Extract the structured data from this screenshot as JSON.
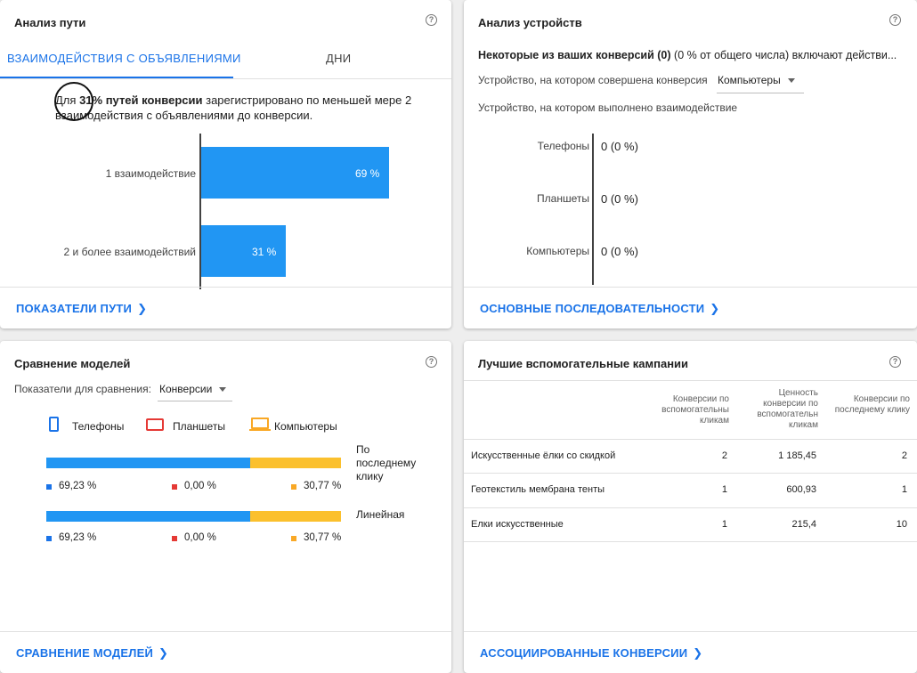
{
  "path_card": {
    "title": "Анализ пути",
    "help": "?",
    "tabs": [
      {
        "label": "ВЗАИМОДЕЙСТВИЯ С ОБЪЯВЛЕНИЯМИ",
        "active": true
      },
      {
        "label": "ДНИ",
        "active": false
      }
    ],
    "desc_prefix": "Для",
    "desc_value": "31",
    "desc_bold": "% путей конверсии",
    "desc_rest": "зарегистрировано по меньшей мере 2 взаимодействия с объявлениями до конверсии.",
    "bars": [
      {
        "label": "1 взаимодействие",
        "value": 69,
        "value_text": "69 %"
      },
      {
        "label": "2 и более взаимодействий",
        "value": 31,
        "value_text": "31 %"
      }
    ],
    "footer_link": "ПОКАЗАТЕЛИ ПУТИ",
    "chev": "❯"
  },
  "device_card": {
    "title": "Анализ устройств",
    "help": "?",
    "head_bold": "Некоторые из ваших конверсий (0)",
    "head_rest": "(0 % от общего числа) включают действи...",
    "conv_device_label": "Устройство, на котором совершена конверсия",
    "conv_device_value": "Компьютеры",
    "interact_label": "Устройство, на котором выполнено взаимодействие",
    "rows": [
      {
        "name": "Телефоны",
        "value": "0 (0 %)"
      },
      {
        "name": "Планшеты",
        "value": "0 (0 %)"
      },
      {
        "name": "Компьютеры",
        "value": "0 (0 %)"
      }
    ],
    "footer_link": "ОСНОВНЫЕ ПОСЛЕДОВАТЕЛЬНОСТИ",
    "chev": "❯"
  },
  "model_card": {
    "title": "Сравнение моделей",
    "help": "?",
    "metric_label": "Показатели для сравнения:",
    "metric_value": "Конверсии",
    "legend": [
      "Телефоны",
      "Планшеты",
      "Компьютеры"
    ],
    "colors": {
      "phones": "#2196f3",
      "tablets": "#e53935",
      "desktops": "#fbc02d"
    },
    "models": [
      {
        "name": "По последнему клику",
        "phones": 69.23,
        "tablets": 0.0,
        "desktops": 30.77,
        "phones_text": "69,23 %",
        "tablets_text": "0,00 %",
        "desktops_text": "30,77 %"
      },
      {
        "name": "Линейная",
        "phones": 69.23,
        "tablets": 0.0,
        "desktops": 30.77,
        "phones_text": "69,23 %",
        "tablets_text": "0,00 %",
        "desktops_text": "30,77 %"
      }
    ],
    "footer_link": "СРАВНЕНИЕ МОДЕЛЕЙ",
    "chev": "❯"
  },
  "campaign_card": {
    "title": "Лучшие вспомогательные кампании",
    "help": "?",
    "headers": [
      "Конверсии по вспомогательны кликам",
      "Ценность конверсии по вспомогательн кликам",
      "Конверсии по последнему клику"
    ],
    "rows": [
      {
        "name": "Искусственные ёлки со скидкой",
        "c1": "2",
        "c2": "1 185,45",
        "c3": "2"
      },
      {
        "name": "Геотекстиль мембрана тенты",
        "c1": "1",
        "c2": "600,93",
        "c3": "1"
      },
      {
        "name": "Елки искусственные",
        "c1": "1",
        "c2": "215,4",
        "c3": "10"
      }
    ],
    "footer_link": "АССОЦИИРОВАННЫЕ КОНВЕРСИИ",
    "chev": "❯"
  }
}
